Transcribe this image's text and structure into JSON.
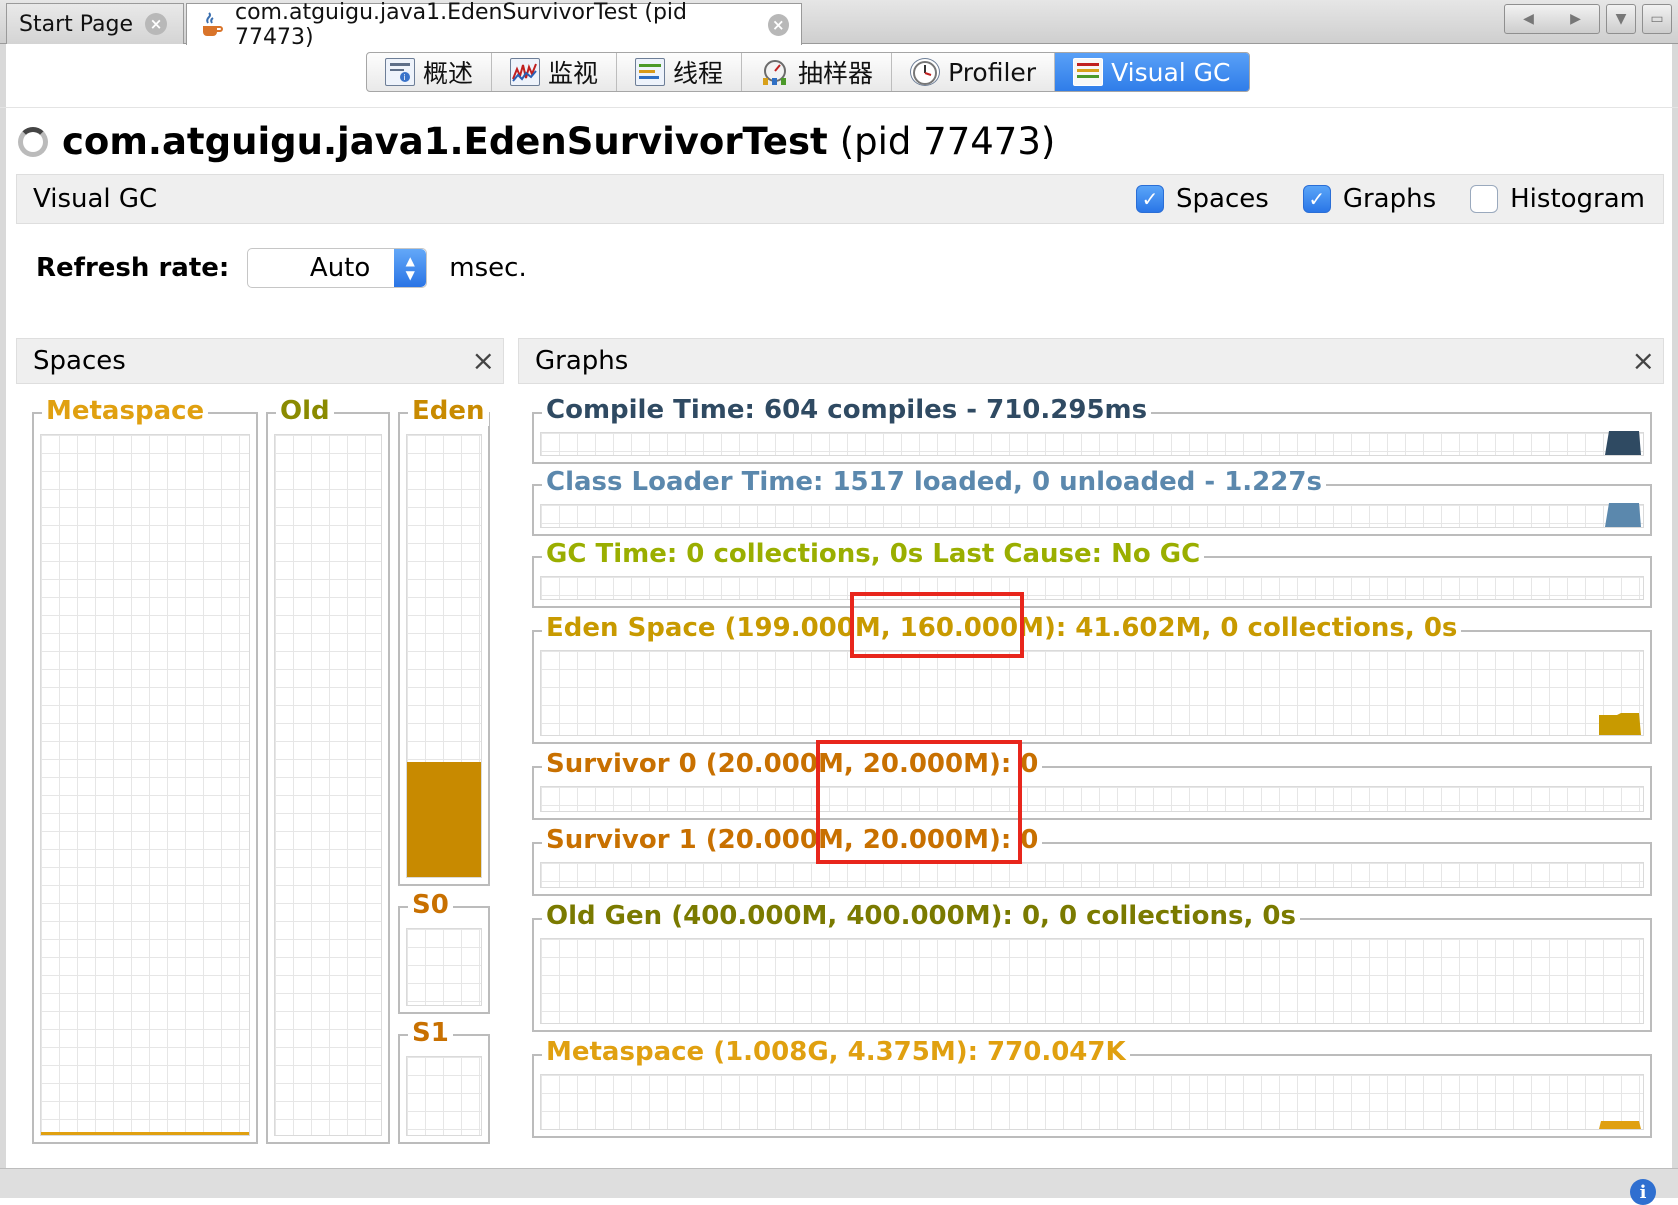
{
  "tabs": [
    {
      "label": "Start Page",
      "active": false
    },
    {
      "label": "com.atguigu.java1.EdenSurvivorTest (pid 77473)",
      "active": true
    }
  ],
  "view_tabs": [
    {
      "label": "概述",
      "icon": "overview-icon"
    },
    {
      "label": "监视",
      "icon": "monitor-icon"
    },
    {
      "label": "线程",
      "icon": "threads-icon"
    },
    {
      "label": "抽样器",
      "icon": "sampler-icon"
    },
    {
      "label": "Profiler",
      "icon": "profiler-icon"
    },
    {
      "label": "Visual GC",
      "icon": "visual-gc-icon",
      "selected": true
    }
  ],
  "title": {
    "main": "com.atguigu.java1.EdenSurvivorTest",
    "pid": "(pid 77473)"
  },
  "vgc_bar": {
    "label": "Visual GC",
    "checkboxes": [
      {
        "label": "Spaces",
        "checked": true
      },
      {
        "label": "Graphs",
        "checked": true
      },
      {
        "label": "Histogram",
        "checked": false
      }
    ]
  },
  "refresh": {
    "label": "Refresh rate:",
    "value": "Auto",
    "unit": "msec."
  },
  "spaces_panel": {
    "title": "Spaces",
    "close": "×",
    "spaces": [
      {
        "label": "Metaspace",
        "color": "#e0a010",
        "fill_fraction": 0.004
      },
      {
        "label": "Old",
        "color": "#8a8a00",
        "fill_fraction": 0
      },
      {
        "label": "Eden",
        "color": "#c88a00",
        "fill_fraction": 0.26
      },
      {
        "label": "S0",
        "color": "#c87000",
        "fill_fraction": 0
      },
      {
        "label": "S1",
        "color": "#c87000",
        "fill_fraction": 0
      }
    ]
  },
  "graphs_panel": {
    "title": "Graphs",
    "close": "×",
    "graphs": [
      {
        "label": "Compile Time: 604 compiles - 710.295ms",
        "color": "#2f4a62"
      },
      {
        "label": "Class Loader Time: 1517 loaded, 0 unloaded - 1.227s",
        "color": "#5b88ad"
      },
      {
        "label": "GC Time: 0 collections, 0s Last Cause: No GC",
        "color": "#9aae00"
      },
      {
        "label": "Eden Space (199.000M, 160.000M): 41.602M, 0 collections, 0s",
        "color": "#c89a00"
      },
      {
        "label": "Survivor 0 (20.000M, 20.000M): 0",
        "color": "#c87000"
      },
      {
        "label": "Survivor 1 (20.000M, 20.000M): 0",
        "color": "#c87000"
      },
      {
        "label": "Old Gen (400.000M, 400.000M): 0, 0 collections, 0s",
        "color": "#7a7a00"
      },
      {
        "label": "Metaspace (1.008G, 4.375M): 770.047K",
        "color": "#e0a010"
      }
    ]
  },
  "status": {
    "info_icon": "i"
  }
}
